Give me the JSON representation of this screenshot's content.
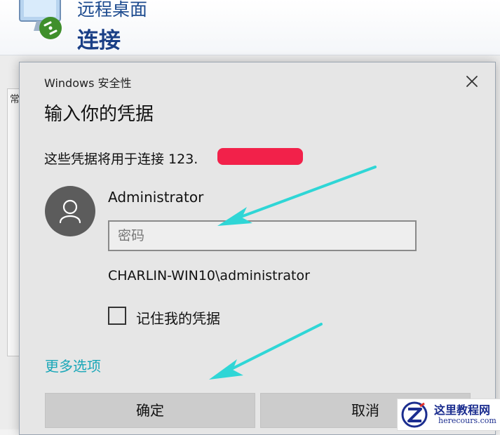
{
  "background_app": {
    "title_line1": "远程桌面",
    "title_line2": "连接",
    "tab_char": "常"
  },
  "dialog": {
    "caption": "Windows 安全性",
    "heading": "输入你的凭据",
    "description": "这些凭据将用于连接 123.",
    "username": "Administrator",
    "password_placeholder": "密码",
    "password_value": "",
    "domain_user": "CHARLIN-WIN10\\administrator",
    "remember_label": "记住我的凭据",
    "remember_checked": false,
    "more_options": "更多选项",
    "ok_label": "确定",
    "cancel_label": "取消"
  },
  "colors": {
    "link": "#1aa7b8",
    "arrow": "#2fd6d6",
    "redaction": "#f2214a",
    "avatar": "#5c5c5c"
  },
  "icons": [
    "remote-desktop-icon",
    "close-icon",
    "user-avatar-icon",
    "checkbox-icon"
  ],
  "watermark": {
    "site_cn": "这里教程网",
    "site_en": "herecours.com"
  }
}
